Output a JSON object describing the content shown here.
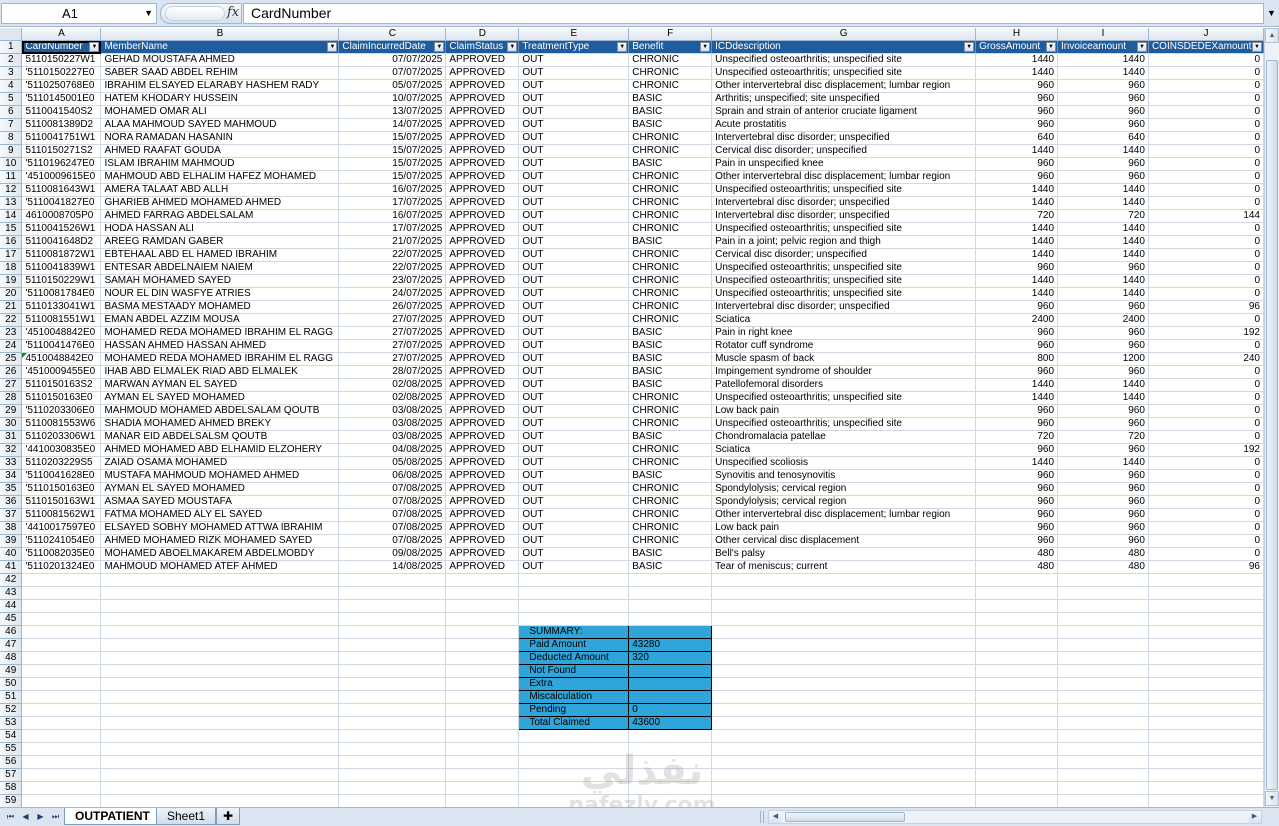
{
  "formula_bar": {
    "name_box": "A1",
    "fx_label": "fx",
    "content": "CardNumber"
  },
  "columns": [
    "A",
    "B",
    "C",
    "D",
    "E",
    "F",
    "G",
    "H",
    "I",
    "J"
  ],
  "header_row": [
    "CardNumber",
    "MemberName",
    "ClaimIncurredDate",
    "ClaimStatus",
    "TreatmentType",
    "Benefit",
    "ICDdescription",
    "GrossAmount",
    "Invoiceamount",
    "COINSDEDEXamount"
  ],
  "rows": [
    [
      "5110150227W1",
      "GEHAD MOUSTAFA AHMED",
      "07/07/2025",
      "APPROVED",
      "OUT",
      "CHRONIC",
      "Unspecified osteoarthritis; unspecified site",
      "1440",
      "1440",
      "0"
    ],
    [
      "'5110150227E0",
      "SABER SAAD ABDEL REHIM",
      "07/07/2025",
      "APPROVED",
      "OUT",
      "CHRONIC",
      "Unspecified osteoarthritis; unspecified site",
      "1440",
      "1440",
      "0"
    ],
    [
      "'5110250768E0",
      "IBRAHIM ELSAYED ELARABY HASHEM RADY",
      "05/07/2025",
      "APPROVED",
      "OUT",
      "CHRONIC",
      "Other intervertebral disc displacement; lumbar region",
      "960",
      "960",
      "0"
    ],
    [
      "'5110145001E0",
      "HATEM KHODARY  HUSSEIN",
      "10/07/2025",
      "APPROVED",
      "OUT",
      "BASIC",
      "Arthritis; unspecified; site unspecified",
      "960",
      "960",
      "0"
    ],
    [
      "5110041540S2",
      "MOHAMED OMAR ALI",
      "13/07/2025",
      "APPROVED",
      "OUT",
      "BASIC",
      "Sprain and strain of anterior cruciate ligament",
      "960",
      "960",
      "0"
    ],
    [
      "5110081389D2",
      "ALAA MAHMOUD SAYED MAHMOUD",
      "14/07/2025",
      "APPROVED",
      "OUT",
      "BASIC",
      "Acute prostatitis",
      "960",
      "960",
      "0"
    ],
    [
      "5110041751W1",
      "NORA RAMADAN HASANIN",
      "15/07/2025",
      "APPROVED",
      "OUT",
      "CHRONIC",
      "Intervertebral disc disorder; unspecified",
      "640",
      "640",
      "0"
    ],
    [
      "5110150271S2",
      "AHMED RAAFAT GOUDA",
      "15/07/2025",
      "APPROVED",
      "OUT",
      "CHRONIC",
      "Cervical disc disorder; unspecified",
      "1440",
      "1440",
      "0"
    ],
    [
      "'5110196247E0",
      "ISLAM IBRAHIM MAHMOUD",
      "15/07/2025",
      "APPROVED",
      "OUT",
      "BASIC",
      "Pain in unspecified knee",
      "960",
      "960",
      "0"
    ],
    [
      "'4510009615E0",
      "MAHMOUD ABD ELHALIM HAFEZ MOHAMED",
      "15/07/2025",
      "APPROVED",
      "OUT",
      "CHRONIC",
      "Other intervertebral disc displacement; lumbar region",
      "960",
      "960",
      "0"
    ],
    [
      "5110081643W1",
      "AMERA TALAAT ABD ALLH",
      "16/07/2025",
      "APPROVED",
      "OUT",
      "CHRONIC",
      "Unspecified osteoarthritis; unspecified site",
      "1440",
      "1440",
      "0"
    ],
    [
      "'5110041827E0",
      "GHARIEB AHMED MOHAMED AHMED",
      "17/07/2025",
      "APPROVED",
      "OUT",
      "CHRONIC",
      "Intervertebral disc disorder; unspecified",
      "1440",
      "1440",
      "0"
    ],
    [
      "4610008705P0",
      "AHMED FARRAG ABDELSALAM",
      "16/07/2025",
      "APPROVED",
      "OUT",
      "CHRONIC",
      "Intervertebral disc disorder; unspecified",
      "720",
      "720",
      "144"
    ],
    [
      "5110041526W1",
      "HODA HASSAN ALI",
      "17/07/2025",
      "APPROVED",
      "OUT",
      "CHRONIC",
      "Unspecified osteoarthritis; unspecified site",
      "1440",
      "1440",
      "0"
    ],
    [
      "5110041648D2",
      "AREEG RAMDAN GABER",
      "21/07/2025",
      "APPROVED",
      "OUT",
      "BASIC",
      "Pain in a joint; pelvic region and thigh",
      "1440",
      "1440",
      "0"
    ],
    [
      "5110081872W1",
      "EBTEHAAL ABD EL HAMED IBRAHIM",
      "22/07/2025",
      "APPROVED",
      "OUT",
      "CHRONIC",
      "Cervical disc disorder; unspecified",
      "1440",
      "1440",
      "0"
    ],
    [
      "5110041839W1",
      "ENTESAR ABDELNAIEM NAIEM",
      "22/07/2025",
      "APPROVED",
      "OUT",
      "CHRONIC",
      "Unspecified osteoarthritis; unspecified site",
      "960",
      "960",
      "0"
    ],
    [
      "5110150229W1",
      "SAMAH MOHAMED SAYED",
      "23/07/2025",
      "APPROVED",
      "OUT",
      "CHRONIC",
      "Unspecified osteoarthritis; unspecified site",
      "1440",
      "1440",
      "0"
    ],
    [
      "'5110081784E0",
      "NOUR EL DIN WASFYE ATRIES",
      "24/07/2025",
      "APPROVED",
      "OUT",
      "CHRONIC",
      "Unspecified osteoarthritis; unspecified site",
      "1440",
      "1440",
      "0"
    ],
    [
      "5110133041W1",
      "BASMA MESTAADY MOHAMED",
      "26/07/2025",
      "APPROVED",
      "OUT",
      "CHRONIC",
      "Intervertebral disc disorder; unspecified",
      "960",
      "960",
      "96"
    ],
    [
      "5110081551W1",
      "EMAN ABDEL AZZIM MOUSA",
      "27/07/2025",
      "APPROVED",
      "OUT",
      "CHRONIC",
      "Sciatica",
      "2400",
      "2400",
      "0"
    ],
    [
      "'4510048842E0",
      "MOHAMED REDA MOHAMED IBRAHIM EL RAGG",
      "27/07/2025",
      "APPROVED",
      "OUT",
      "BASIC",
      "Pain in right knee",
      "960",
      "960",
      "192"
    ],
    [
      "'5110041476E0",
      "HASSAN AHMED HASSAN AHMED",
      "27/07/2025",
      "APPROVED",
      "OUT",
      "BASIC",
      "Rotator cuff syndrome",
      "960",
      "960",
      "0"
    ],
    [
      "4510048842E0",
      "MOHAMED REDA MOHAMED IBRAHIM EL RAGG",
      "27/07/2025",
      "APPROVED",
      "OUT",
      "BASIC",
      "Muscle spasm of back",
      "800",
      "1200",
      "240"
    ],
    [
      "'4510009455E0",
      "IHAB ABD ELMALEK RIAD ABD ELMALEK",
      "28/07/2025",
      "APPROVED",
      "OUT",
      "BASIC",
      "Impingement syndrome of shoulder",
      "960",
      "960",
      "0"
    ],
    [
      "5110150163S2",
      "MARWAN AYMAN EL SAYED",
      "02/08/2025",
      "APPROVED",
      "OUT",
      "BASIC",
      "Patellofemoral disorders",
      "1440",
      "1440",
      "0"
    ],
    [
      "5110150163E0",
      "AYMAN EL SAYED MOHAMED",
      "02/08/2025",
      "APPROVED",
      "OUT",
      "CHRONIC",
      "Unspecified osteoarthritis; unspecified site",
      "1440",
      "1440",
      "0"
    ],
    [
      "'5110203306E0",
      "MAHMOUD MOHAMED ABDELSALAM QOUTB",
      "03/08/2025",
      "APPROVED",
      "OUT",
      "CHRONIC",
      "Low back pain",
      "960",
      "960",
      "0"
    ],
    [
      "5110081553W6",
      "SHADIA MOHAMED AHMED BREKY",
      "03/08/2025",
      "APPROVED",
      "OUT",
      "CHRONIC",
      "Unspecified osteoarthritis; unspecified site",
      "960",
      "960",
      "0"
    ],
    [
      "5110203306W1",
      "MANAR EID ABDELSALSM QOUTB",
      "03/08/2025",
      "APPROVED",
      "OUT",
      "BASIC",
      "Chondromalacia patellae",
      "720",
      "720",
      "0"
    ],
    [
      "'4410030835E0",
      "AHMED MOHAMED ABD ELHAMID ELZOHERY",
      "04/08/2025",
      "APPROVED",
      "OUT",
      "CHRONIC",
      "Sciatica",
      "960",
      "960",
      "192"
    ],
    [
      "5110203229S5",
      "ZAIAD OSAMA MOHAMED",
      "05/08/2025",
      "APPROVED",
      "OUT",
      "CHRONIC",
      "Unspecified scoliosis",
      "1440",
      "1440",
      "0"
    ],
    [
      "'5110041628E0",
      "MUSTAFA MAHMOUD MOHAMED AHMED",
      "06/08/2025",
      "APPROVED",
      "OUT",
      "BASIC",
      "Synovitis and tenosynovitis",
      "960",
      "960",
      "0"
    ],
    [
      "'5110150163E0",
      "AYMAN EL SAYED MOHAMED",
      "07/08/2025",
      "APPROVED",
      "OUT",
      "CHRONIC",
      "Spondylolysis; cervical region",
      "960",
      "960",
      "0"
    ],
    [
      "5110150163W1",
      "ASMAA SAYED MOUSTAFA",
      "07/08/2025",
      "APPROVED",
      "OUT",
      "CHRONIC",
      "Spondylolysis; cervical region",
      "960",
      "960",
      "0"
    ],
    [
      "5110081562W1",
      "FATMA MOHAMED ALY EL SAYED",
      "07/08/2025",
      "APPROVED",
      "OUT",
      "CHRONIC",
      "Other intervertebral disc displacement; lumbar region",
      "960",
      "960",
      "0"
    ],
    [
      "'4410017597E0",
      "ELSAYED SOBHY MOHAMED ATTWA IBRAHIM",
      "07/08/2025",
      "APPROVED",
      "OUT",
      "CHRONIC",
      "Low back pain",
      "960",
      "960",
      "0"
    ],
    [
      "'5110241054E0",
      "AHMED MOHAMED RIZK MOHAMED SAYED",
      "07/08/2025",
      "APPROVED",
      "OUT",
      "CHRONIC",
      "Other cervical disc displacement",
      "960",
      "960",
      "0"
    ],
    [
      "'5110082035E0",
      "MOHAMED ABOELMAKAREM ABDELMOBDY",
      "09/08/2025",
      "APPROVED",
      "OUT",
      "BASIC",
      "Bell's palsy",
      "480",
      "480",
      "0"
    ],
    [
      "'5110201324E0",
      "MAHMOUD MOHAMED ATEF AHMED",
      "14/08/2025",
      "APPROVED",
      "OUT",
      "BASIC",
      "Tear of meniscus; current",
      "480",
      "480",
      "96"
    ]
  ],
  "summary": [
    {
      "label": "SUMMARY:",
      "value": ""
    },
    {
      "label": "Paid Amount",
      "value": "43280"
    },
    {
      "label": "Deducted Amount",
      "value": "320"
    },
    {
      "label": "Not Found",
      "value": ""
    },
    {
      "label": "Extra",
      "value": ""
    },
    {
      "label": "Miscalculation",
      "value": ""
    },
    {
      "label": "Pending",
      "value": "0"
    },
    {
      "label": "Total Claimed",
      "value": "43600"
    }
  ],
  "sheet_tabs": [
    {
      "label": "OUTPATIENT",
      "active": true
    },
    {
      "label": "Sheet1",
      "active": false
    }
  ],
  "watermark": {
    "arabic": "نفذلي",
    "latin": "nafezly.com"
  },
  "colors": {
    "header_fill": "#1f5c9e",
    "summary_fill": "#2fa5d9",
    "gridline": "#d0d7e5",
    "chrome": "#dbe5f1"
  }
}
